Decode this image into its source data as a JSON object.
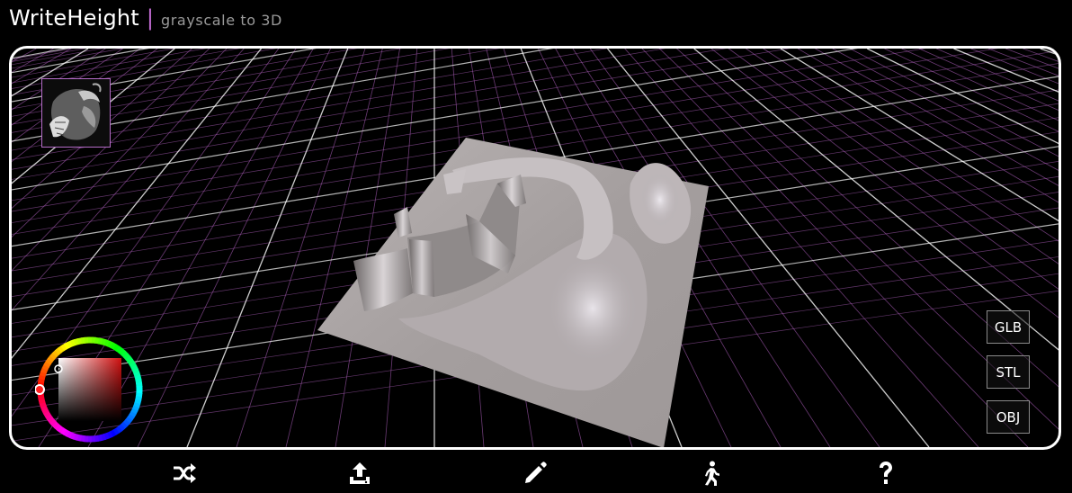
{
  "app": {
    "title": "WriteHeight",
    "separator": "|",
    "subtitle": "grayscale to 3D"
  },
  "colors": {
    "background": "#000000",
    "frame": "#ffffff",
    "accent": "#c06ad0",
    "grid_major": "#ffffff",
    "grid_minor": "#b060c0",
    "mesh": "#a8a3a3"
  },
  "viewport": {
    "thumbnail_icon": "grayscale-heightmap-thumbnail",
    "color_picker": {
      "selected_hue": "#ff0000",
      "icon": "color-wheel-icon"
    },
    "export_buttons": [
      {
        "label": "GLB"
      },
      {
        "label": "STL"
      },
      {
        "label": "OBJ"
      }
    ]
  },
  "toolbar": {
    "items": [
      {
        "icon": "shuffle-icon",
        "action": "random"
      },
      {
        "icon": "upload-icon",
        "action": "upload"
      },
      {
        "icon": "pencil-icon",
        "action": "draw"
      },
      {
        "icon": "walk-icon",
        "action": "walk"
      },
      {
        "icon": "help-icon",
        "action": "help"
      }
    ]
  }
}
